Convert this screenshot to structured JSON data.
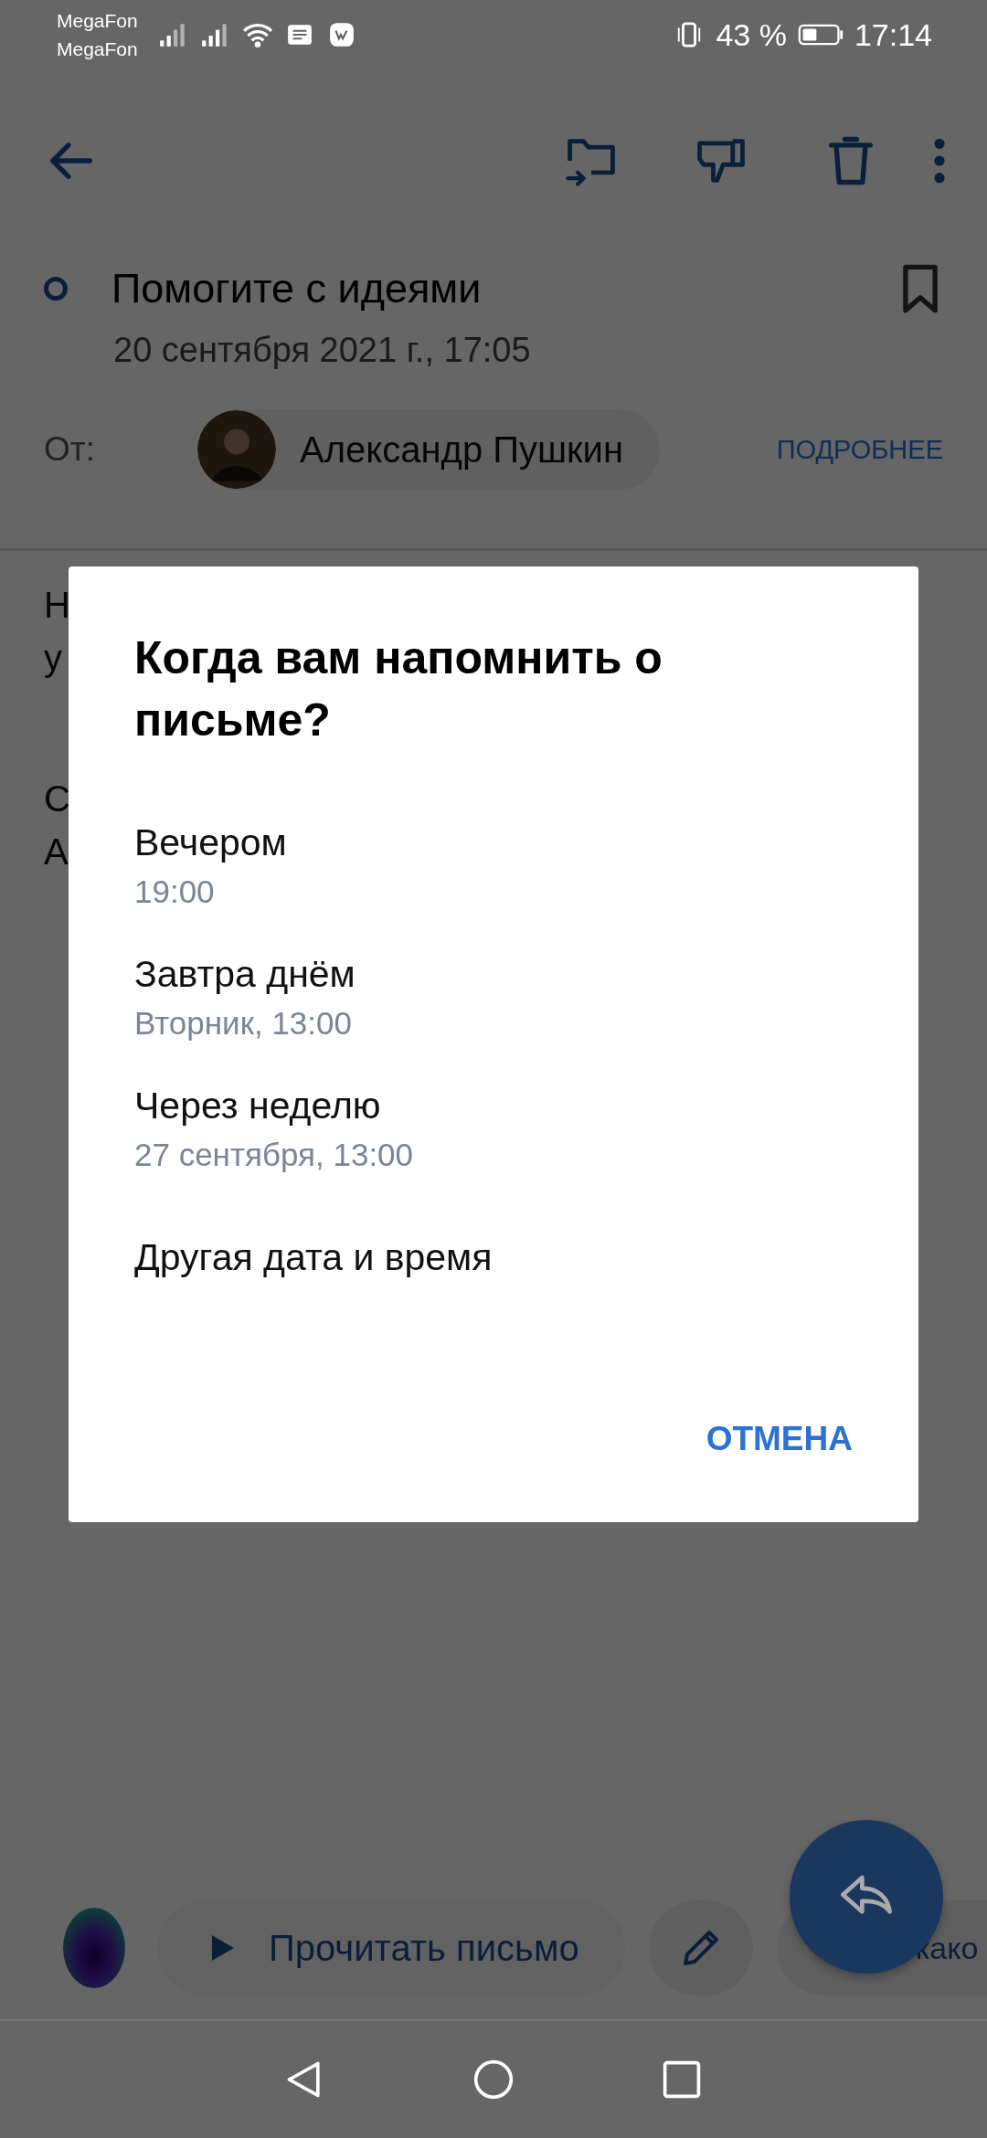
{
  "status_bar": {
    "carriers": [
      "MegaFon",
      "MegaFon"
    ],
    "battery_text": "43 %",
    "time": "17:14"
  },
  "message": {
    "subject": "Помогите с идеями",
    "read": false,
    "date": "20 сентября 2021 г., 17:05",
    "from_label": "От:",
    "sender": "Александр Пушкин",
    "details_link": "ПОДРОБНЕЕ",
    "body_paragraphs": [
      [
        "Н",
        "у"
      ],
      [
        "С",
        "А"
      ]
    ]
  },
  "dialog": {
    "title": "Когда вам напомнить о письме?",
    "options": [
      {
        "label": "Вечером",
        "detail": "19:00"
      },
      {
        "label": "Завтра днём",
        "detail": "Вторник, 13:00"
      },
      {
        "label": "Через неделю",
        "detail": "27 сентября, 13:00"
      },
      {
        "label": "Другая дата и время"
      }
    ],
    "cancel": "ОТМЕНА"
  },
  "bottom_bar": {
    "read_aloud": "Прочитать письмо",
    "chip": "како"
  }
}
